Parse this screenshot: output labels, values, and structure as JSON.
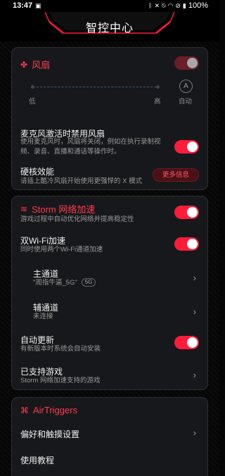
{
  "status_bar": {
    "time": "13:47",
    "battery": "100%",
    "left_icons": [
      "gallery-icon"
    ],
    "right_icons": [
      "bluetooth-icon",
      "x-icon",
      "mute-icon",
      "wifi-icon",
      "no-sim-icon",
      "battery-icon"
    ]
  },
  "header": {
    "title": "智控中心"
  },
  "fan": {
    "title": "风扇",
    "low_label": "低",
    "high_label": "高",
    "auto_letter": "A",
    "auto_label": "自动",
    "mic_title": "麦克风激活时禁用风扇",
    "mic_desc_line1": "使用麦克风时，风扇将关闭，例如在执行录制视",
    "mic_desc_line2": "频、录音、直播和通话等操作时。",
    "hardcore_title": "硬核效能",
    "hardcore_desc": "请插上酷冷风扇开始使用更强悍的 X 模式",
    "more_info": "更多信息"
  },
  "storm": {
    "title": "Storm 网络加速",
    "desc": "游戏过程中自动优化网络并提高稳定性",
    "dual_wifi_title": "双Wi-Fi加速",
    "dual_wifi_desc": "同时使用两个Wi-Fi通道加速",
    "main_channel_title": "主通道",
    "main_channel_value": "\"周指牛逼_5G\"",
    "main_channel_badge": "5G",
    "aux_channel_title": "辅通道",
    "aux_channel_value": "未连接",
    "auto_update_title": "自动更新",
    "auto_update_desc": "有新版本时系统会自动安装",
    "supported_title": "已支持游戏",
    "supported_desc": "Storm 网络加速支持的游戏"
  },
  "airtriggers": {
    "title": "AirTriggers",
    "prefs": "偏好和触摸设置",
    "tutorial": "使用教程"
  },
  "colors": {
    "accent": "#ff1c3a",
    "card": "#17181b",
    "background": "#050505"
  }
}
